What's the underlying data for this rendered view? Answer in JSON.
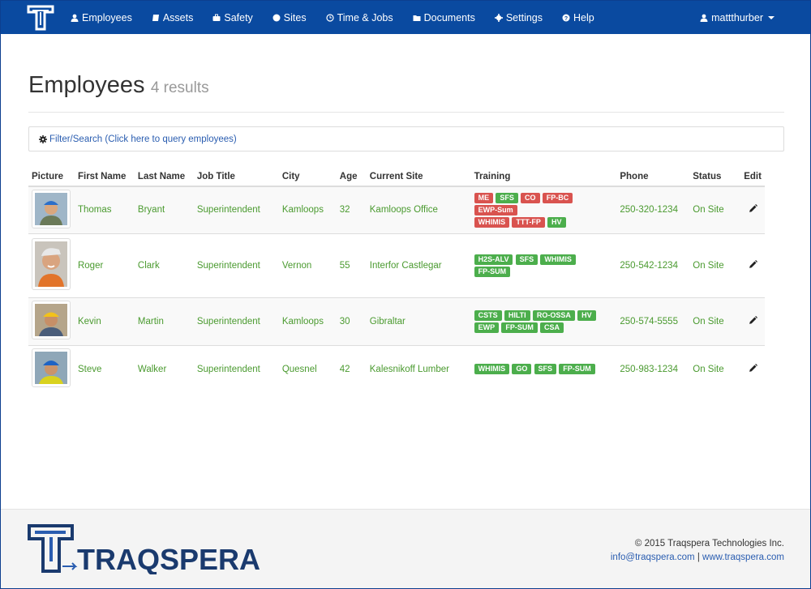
{
  "nav": {
    "items": [
      {
        "label": "Employees",
        "icon": "user-icon"
      },
      {
        "label": "Assets",
        "icon": "book-icon"
      },
      {
        "label": "Safety",
        "icon": "briefcase-icon"
      },
      {
        "label": "Sites",
        "icon": "globe-icon"
      },
      {
        "label": "Time & Jobs",
        "icon": "clock-icon"
      },
      {
        "label": "Documents",
        "icon": "folder-icon"
      },
      {
        "label": "Settings",
        "icon": "gear-icon"
      },
      {
        "label": "Help",
        "icon": "question-icon"
      }
    ],
    "user": "mattthurber"
  },
  "header": {
    "title": "Employees",
    "count": "4 results"
  },
  "filter": {
    "label": "Filter/Search (Click here to query employees)"
  },
  "table": {
    "columns": [
      "Picture",
      "First Name",
      "Last Name",
      "Job Title",
      "City",
      "Age",
      "Current Site",
      "Training",
      "Phone",
      "Status",
      "Edit"
    ],
    "rows": [
      {
        "first": "Thomas",
        "last": "Bryant",
        "job": "Superintendent",
        "city": "Kamloops",
        "age": "32",
        "site": "Kamloops Office",
        "training": [
          {
            "label": "ME",
            "color": "red"
          },
          {
            "label": "SFS",
            "color": "green"
          },
          {
            "label": "CO",
            "color": "red"
          },
          {
            "label": "FP-BC",
            "color": "red"
          },
          {
            "label": "EWP-Sum",
            "color": "red"
          },
          {
            "label": "WHIMIS",
            "color": "red"
          },
          {
            "label": "TTT-FP",
            "color": "red"
          },
          {
            "label": "HV",
            "color": "green"
          }
        ],
        "phone": "250-320-1234",
        "status": "On Site"
      },
      {
        "first": "Roger",
        "last": "Clark",
        "job": "Superintendent",
        "city": "Vernon",
        "age": "55",
        "site": "Interfor Castlegar",
        "training": [
          {
            "label": "H2S-ALV",
            "color": "green"
          },
          {
            "label": "SFS",
            "color": "green"
          },
          {
            "label": "WHIMIS",
            "color": "green"
          },
          {
            "label": "FP-SUM",
            "color": "green"
          }
        ],
        "phone": "250-542-1234",
        "status": "On Site"
      },
      {
        "first": "Kevin",
        "last": "Martin",
        "job": "Superintendent",
        "city": "Kamloops",
        "age": "30",
        "site": "Gibraltar",
        "training": [
          {
            "label": "CSTS",
            "color": "green"
          },
          {
            "label": "HILTI",
            "color": "green"
          },
          {
            "label": "RO-OSSA",
            "color": "green"
          },
          {
            "label": "HV",
            "color": "green"
          },
          {
            "label": "EWP",
            "color": "green"
          },
          {
            "label": "FP-SUM",
            "color": "green"
          },
          {
            "label": "CSA",
            "color": "green"
          }
        ],
        "phone": "250-574-5555",
        "status": "On Site"
      },
      {
        "first": "Steve",
        "last": "Walker",
        "job": "Superintendent",
        "city": "Quesnel",
        "age": "42",
        "site": "Kalesnikoff Lumber",
        "training": [
          {
            "label": "WHIMIS",
            "color": "green"
          },
          {
            "label": "GO",
            "color": "green"
          },
          {
            "label": "SFS",
            "color": "green"
          },
          {
            "label": "FP-SUM",
            "color": "green"
          }
        ],
        "phone": "250-983-1234",
        "status": "On Site"
      }
    ]
  },
  "footer": {
    "logo_text": "TRAQSPERA",
    "copyright": "© 2015 Traqspera Technologies Inc.",
    "email": "info@traqspera.com",
    "separator": "|",
    "website": "www.traqspera.com"
  },
  "colors": {
    "navbar": "#0a4aa0",
    "link": "#2a5db0",
    "value_green": "#4a9a2f",
    "badge_green": "#4cae4c",
    "badge_red": "#d9534f"
  }
}
